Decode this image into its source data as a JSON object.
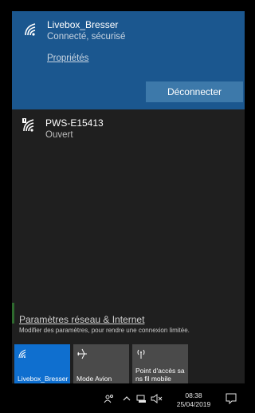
{
  "connected_network": {
    "name": "Livebox_Bresser",
    "status": "Connecté, sécurisé",
    "properties_link": "Propriétés",
    "disconnect_label": "Déconnecter",
    "icon": "wifi-signal-icon"
  },
  "other_networks": [
    {
      "name": "PWS-E15413",
      "status": "Ouvert",
      "icon": "wifi-open-warning-icon"
    }
  ],
  "settings": {
    "link_label": "Paramètres réseau & Internet",
    "subtitle": "Modifier des paramètres, pour rendre une connexion limitée."
  },
  "quick_actions": [
    {
      "label": "Livebox_Bresser",
      "icon": "wifi-icon",
      "active": true
    },
    {
      "label": "Mode Avion",
      "icon": "airplane-icon",
      "active": false
    },
    {
      "label": "Point d'accès sans fil mobile",
      "icon": "hotspot-icon",
      "active": false
    }
  ],
  "taskbar": {
    "time": "08:38",
    "date": "25/04/2019",
    "icons": [
      "people-icon",
      "chevron-up-icon",
      "network-icon",
      "volume-muted-icon",
      "notification-icon"
    ]
  },
  "colors": {
    "connected_bg": "#1b578f",
    "flyout_bg": "#1f1f1f",
    "button_bg": "#3d79aa",
    "active_tile": "#0f6fcf",
    "inactive_tile": "#4a4a4a"
  }
}
